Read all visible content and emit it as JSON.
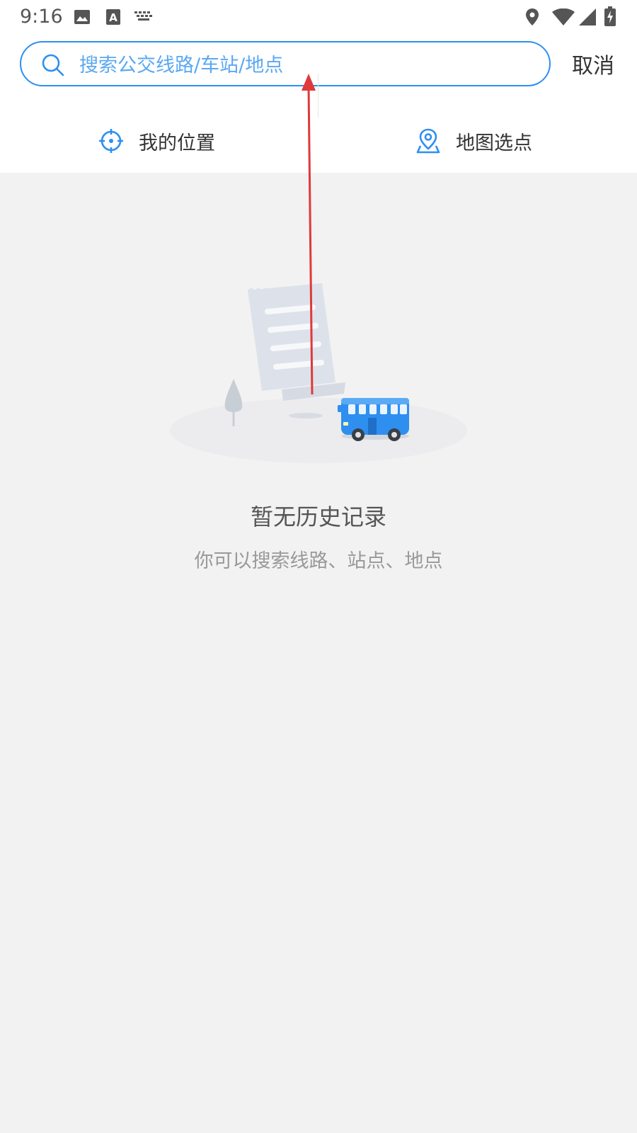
{
  "status_bar": {
    "time": "9:16",
    "icons": [
      "image-icon",
      "text-a-icon",
      "keyboard-icon",
      "location-pin-icon",
      "wifi-icon",
      "signal-icon",
      "battery-charging-icon"
    ]
  },
  "search": {
    "placeholder": "搜索公交线路/车站/地点",
    "value": "",
    "cancel_label": "取消"
  },
  "quick_actions": {
    "my_location": "我的位置",
    "map_pick": "地图选点"
  },
  "empty_state": {
    "title": "暂无历史记录",
    "subtitle": "你可以搜索线路、站点、地点"
  },
  "colors": {
    "accent": "#2e8ff0",
    "placeholder": "#5aa8f2",
    "page_bg": "#f2f2f2",
    "annotation_arrow": "#e0393b"
  }
}
